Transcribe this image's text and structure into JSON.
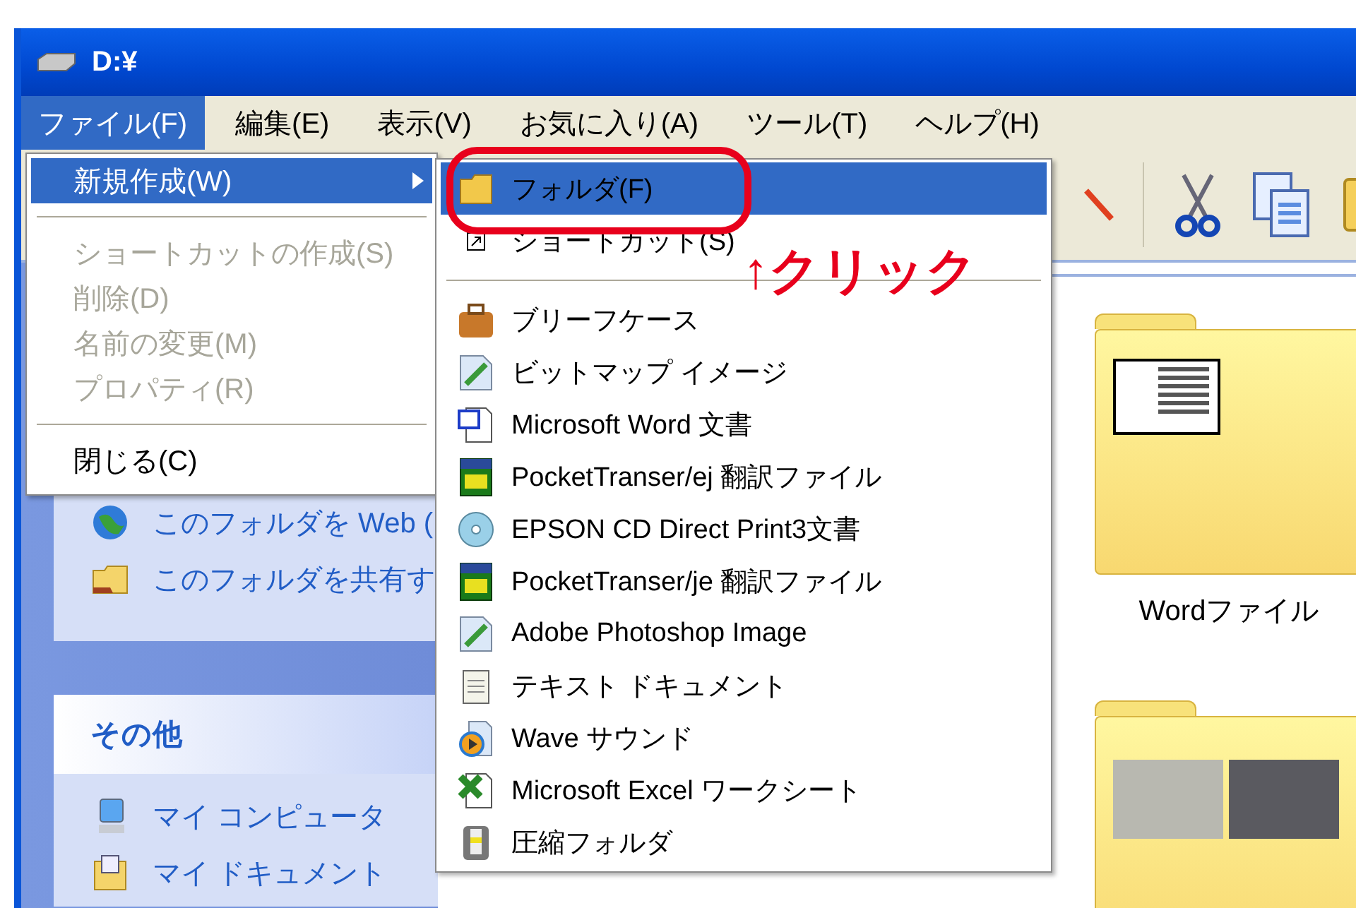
{
  "window": {
    "title": "D:¥"
  },
  "menu_bar": [
    {
      "label": "ファイル(F)",
      "selected": true
    },
    {
      "label": "編集(E)",
      "selected": false
    },
    {
      "label": "表示(V)",
      "selected": false
    },
    {
      "label": "お気に入り(A)",
      "selected": false
    },
    {
      "label": "ツール(T)",
      "selected": false
    },
    {
      "label": "ヘルプ(H)",
      "selected": false
    }
  ],
  "file_menu": [
    {
      "kind": "item",
      "label": "新規作成(W)",
      "selected": true,
      "disabled": false,
      "submenu": true
    },
    {
      "kind": "separator"
    },
    {
      "kind": "item",
      "label": "ショートカットの作成(S)",
      "selected": false,
      "disabled": true,
      "submenu": false
    },
    {
      "kind": "item",
      "label": "削除(D)",
      "selected": false,
      "disabled": true,
      "submenu": false
    },
    {
      "kind": "item",
      "label": "名前の変更(M)",
      "selected": false,
      "disabled": true,
      "submenu": false
    },
    {
      "kind": "item",
      "label": "プロパティ(R)",
      "selected": false,
      "disabled": true,
      "submenu": false
    },
    {
      "kind": "separator"
    },
    {
      "kind": "item",
      "label": "閉じる(C)",
      "selected": false,
      "disabled": false,
      "submenu": false
    }
  ],
  "new_submenu": [
    {
      "kind": "item",
      "label": "フォルダ(F)",
      "selected": true
    },
    {
      "kind": "item",
      "label": "ショートカット(S)",
      "selected": false
    },
    {
      "kind": "separator"
    },
    {
      "kind": "item",
      "label": "ブリーフケース",
      "selected": false
    },
    {
      "kind": "item",
      "label": "ビットマップ イメージ",
      "selected": false
    },
    {
      "kind": "item",
      "label": "Microsoft Word 文書",
      "selected": false
    },
    {
      "kind": "item",
      "label": "PocketTranser/ej 翻訳ファイル",
      "selected": false
    },
    {
      "kind": "item",
      "label": "EPSON CD Direct Print3文書",
      "selected": false
    },
    {
      "kind": "item",
      "label": "PocketTranser/je 翻訳ファイル",
      "selected": false
    },
    {
      "kind": "item",
      "label": "Adobe Photoshop Image",
      "selected": false
    },
    {
      "kind": "item",
      "label": "テキスト ドキュメント",
      "selected": false
    },
    {
      "kind": "item",
      "label": "Wave サウンド",
      "selected": false
    },
    {
      "kind": "item",
      "label": "Microsoft Excel ワークシート",
      "selected": false
    },
    {
      "kind": "item",
      "label": "圧縮フォルダ",
      "selected": false
    }
  ],
  "annotation": {
    "text": "↑クリック"
  },
  "task_panes": [
    {
      "items": [
        {
          "label": "このフォルダを Web ("
        },
        {
          "label": "このフォルダを共有す"
        }
      ]
    },
    {
      "title": "その他",
      "items": [
        {
          "label": "マイ コンピュータ"
        },
        {
          "label": "マイ ドキュメント"
        }
      ]
    }
  ],
  "folders": [
    {
      "kind": "document",
      "name": "Wordファイル"
    },
    {
      "kind": "photos"
    }
  ]
}
